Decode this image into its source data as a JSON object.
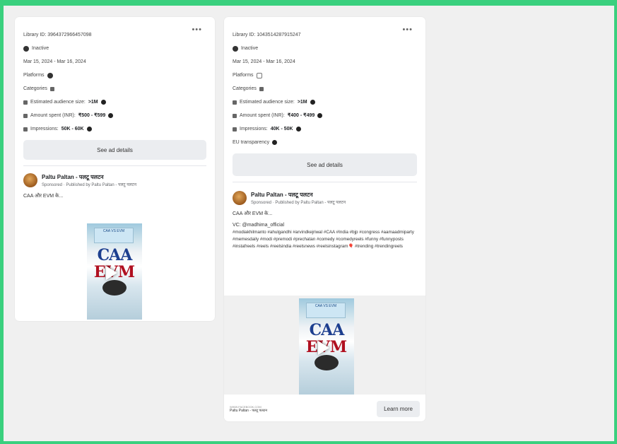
{
  "cards": [
    {
      "library_id": "Library ID: 3964372966457098",
      "status": "Inactive",
      "date_range": "Mar 15, 2024 - Mar 16, 2024",
      "platforms_label": "Platforms",
      "categories_label": "Categories",
      "audience_label": "Estimated audience size:",
      "audience_value": ">1M",
      "spent_label": "Amount spent (INR):",
      "spent_value": "₹500 - ₹599",
      "impressions_label": "Impressions:",
      "impressions_value": "50K - 60K",
      "details_button": "See ad details",
      "page_name": "Paltu Paltan - पलटू पलटन",
      "sponsored": "Sponsored · Published by Paltu Paltan - पलटू पलटन",
      "ad_text": "CAA और EVM के...",
      "more_icon": "ellipsis-icon"
    },
    {
      "library_id": "Library ID: 1043514287915247",
      "status": "Inactive",
      "date_range": "Mar 15, 2024 - Mar 16, 2024",
      "platforms_label": "Platforms",
      "categories_label": "Categories",
      "audience_label": "Estimated audience size:",
      "audience_value": ">1M",
      "spent_label": "Amount spent (INR):",
      "spent_value": "₹400 - ₹499",
      "impressions_label": "Impressions:",
      "impressions_value": "40K - 50K",
      "eu_label": "EU transparency",
      "details_button": "See ad details",
      "page_name": "Paltu Paltan - पलटू पलटन",
      "sponsored": "Sponsored · Published by Paltu Paltan - पलटू पलटन",
      "ad_text": "CAA और EVM के...",
      "ad_text_2": "VC: @madhima_official",
      "hashtags": "#modiakhilmanto #ahulgandhi #arvindkejriwal #CAA #India #bjp #congress #aamaadmiparty #memesdaily #modi #premodi #prechatan #comedy #comedyreels #funny #funnyposts #instafreels #reels #reelsindia #reelsnews #reelsinstagram🎈 #trending #trendingreels",
      "footer_url": "WWW.FACEBOOK.COM",
      "footer_name": "Paltu Paltan - पलटू पलटन",
      "cta": "Learn more",
      "more_icon": "ellipsis-icon"
    }
  ],
  "thumbnail": {
    "banner_text": "CAA VS EVM",
    "line1": "CAA",
    "line2": "EVM"
  }
}
